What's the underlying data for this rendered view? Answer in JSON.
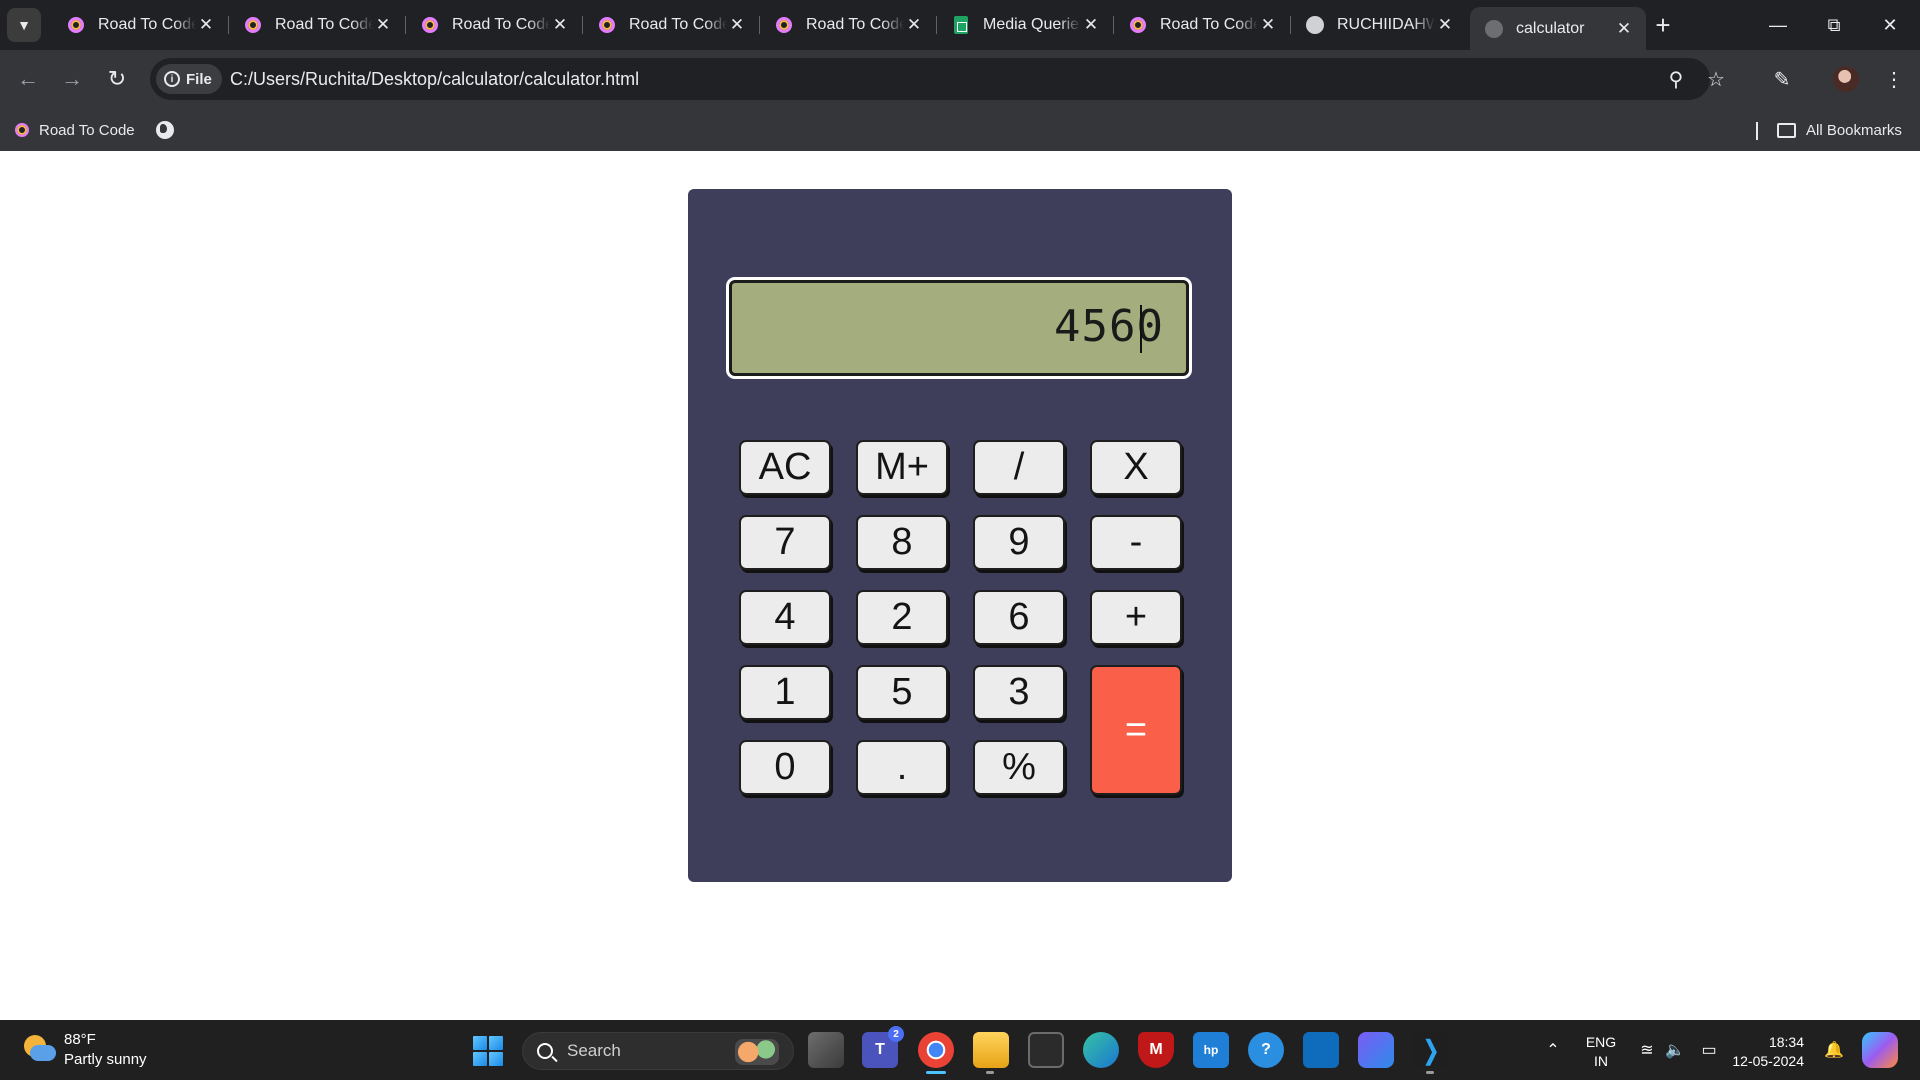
{
  "browser": {
    "tabs": [
      {
        "title": "Road To Code",
        "icon": "road-to-code-icon",
        "active": false
      },
      {
        "title": "Road To Code",
        "icon": "road-to-code-icon",
        "active": false
      },
      {
        "title": "Road To Code",
        "icon": "road-to-code-icon",
        "active": false
      },
      {
        "title": "Road To Code",
        "icon": "road-to-code-icon",
        "active": false
      },
      {
        "title": "Road To Code",
        "icon": "road-to-code-icon",
        "active": false
      },
      {
        "title": "Media Queries",
        "icon": "sheets-icon",
        "active": false
      },
      {
        "title": "Road To Code",
        "icon": "road-to-code-icon",
        "active": false
      },
      {
        "title": "RUCHIIDAHW",
        "icon": "github-icon",
        "active": false
      },
      {
        "title": "calculator",
        "icon": "globe-icon",
        "active": true
      }
    ],
    "address": {
      "scheme_label": "File",
      "url": "C:/Users/Ruchita/Desktop/calculator/calculator.html"
    },
    "bookmarks": [
      {
        "label": "Road To Code",
        "icon": "road-to-code-icon"
      },
      {
        "label": "",
        "icon": "globe-icon"
      }
    ],
    "all_bookmarks_label": "All Bookmarks",
    "colors": {
      "frame": "#202124",
      "toolbar": "#35363a"
    }
  },
  "calculator": {
    "display_value": "4560",
    "colors": {
      "body": "#3e3e5a",
      "display": "#a3ad7d",
      "key": "#ececec",
      "equals": "#fa5f4a"
    },
    "keys": [
      {
        "label": "AC",
        "name": "key-clear"
      },
      {
        "label": "M+",
        "name": "key-memory-plus"
      },
      {
        "label": "/",
        "name": "key-divide"
      },
      {
        "label": "X",
        "name": "key-multiply"
      },
      {
        "label": "7",
        "name": "key-7"
      },
      {
        "label": "8",
        "name": "key-8"
      },
      {
        "label": "9",
        "name": "key-9"
      },
      {
        "label": "-",
        "name": "key-minus"
      },
      {
        "label": "4",
        "name": "key-4"
      },
      {
        "label": "2",
        "name": "key-2"
      },
      {
        "label": "6",
        "name": "key-6"
      },
      {
        "label": "+",
        "name": "key-plus"
      },
      {
        "label": "1",
        "name": "key-1"
      },
      {
        "label": "5",
        "name": "key-5"
      },
      {
        "label": "3",
        "name": "key-3"
      },
      {
        "label": "=",
        "name": "key-equals"
      },
      {
        "label": "0",
        "name": "key-0"
      },
      {
        "label": ".",
        "name": "key-decimal"
      },
      {
        "label": "%",
        "name": "key-percent"
      }
    ]
  },
  "taskbar": {
    "weather": {
      "temp": "88°F",
      "desc": "Partly sunny"
    },
    "search_placeholder": "Search",
    "teams_badge": "2",
    "lang_line1": "ENG",
    "lang_line2": "IN",
    "time": "18:34",
    "date": "12-05-2024"
  }
}
